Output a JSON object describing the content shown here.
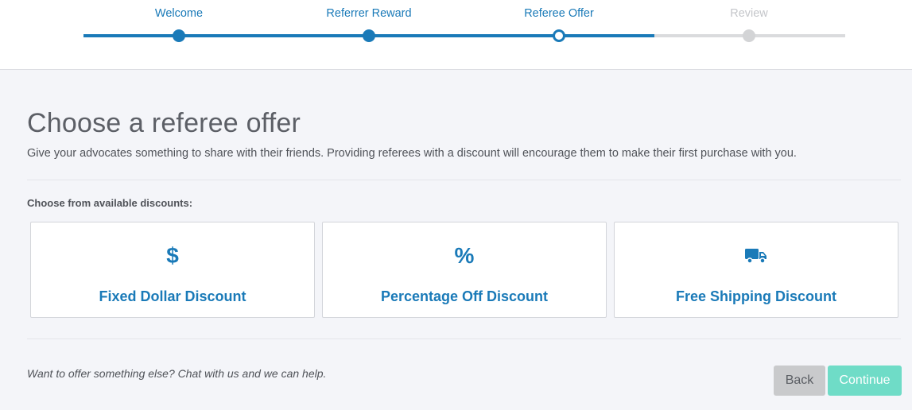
{
  "stepper": {
    "steps": [
      {
        "label": "Welcome",
        "status": "complete"
      },
      {
        "label": "Referrer Reward",
        "status": "complete"
      },
      {
        "label": "Referee Offer",
        "status": "current"
      },
      {
        "label": "Review",
        "status": "upcoming"
      }
    ],
    "active_color": "#1a7ab8",
    "inactive_color": "#d3d4d6"
  },
  "main": {
    "title": "Choose a referee offer",
    "subtitle": "Give your advocates something to share with their friends. Providing referees with a discount will encourage them to make their first purchase with you.",
    "section_label": "Choose from available discounts:",
    "options": [
      {
        "label": "Fixed Dollar Discount",
        "icon": "dollar-icon",
        "glyph": "$"
      },
      {
        "label": "Percentage Off Discount",
        "icon": "percent-icon",
        "glyph": "%"
      },
      {
        "label": "Free Shipping Discount",
        "icon": "truck-icon",
        "glyph": ""
      }
    ],
    "help_text": "Want to offer something else? Chat with us and we can help.",
    "buttons": {
      "back": "Back",
      "continue": "Continue"
    }
  },
  "colors": {
    "accent": "#1a7ab8",
    "continue_button": "#6fdcc7",
    "back_button": "#c9cacc",
    "background": "#f4f5f9"
  }
}
